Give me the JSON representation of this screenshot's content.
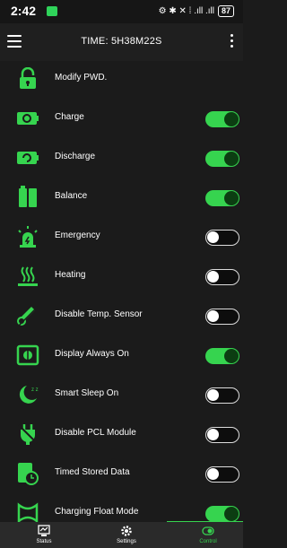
{
  "status_bar": {
    "time": "2:42",
    "icons": "⚙ ✱ ✕ ⁞ .ıll .ıll",
    "battery": "87"
  },
  "toolbar": {
    "title": "TIME: 5H38M22S"
  },
  "colors": {
    "accent": "#36d44f",
    "background": "#1b1b1b"
  },
  "rows": [
    {
      "label": "Modify PWD.",
      "icon": "lock-icon",
      "toggle": null
    },
    {
      "label": "Charge",
      "icon": "battery-charge-icon",
      "toggle": true
    },
    {
      "label": "Discharge",
      "icon": "battery-discharge-icon",
      "toggle": true
    },
    {
      "label": "Balance",
      "icon": "battery-balance-icon",
      "toggle": true
    },
    {
      "label": "Emergency",
      "icon": "emergency-light-icon",
      "toggle": false
    },
    {
      "label": "Heating",
      "icon": "heating-icon",
      "toggle": false
    },
    {
      "label": "Disable Temp. Sensor",
      "icon": "temp-sensor-off-icon",
      "toggle": false
    },
    {
      "label": "Display Always On",
      "icon": "display-icon",
      "toggle": true
    },
    {
      "label": "Smart Sleep On",
      "icon": "moon-sleep-icon",
      "toggle": false
    },
    {
      "label": "Disable PCL Module",
      "icon": "plug-off-icon",
      "toggle": false
    },
    {
      "label": "Timed Stored Data",
      "icon": "timed-data-icon",
      "toggle": false
    },
    {
      "label": "Charging Float Mode",
      "icon": "float-mode-icon",
      "toggle": true
    }
  ],
  "bottom_nav": [
    {
      "label": "Status",
      "icon": "status-icon",
      "active": false
    },
    {
      "label": "Settings",
      "icon": "gear-icon",
      "active": false
    },
    {
      "label": "Control",
      "icon": "control-icon",
      "active": true
    }
  ]
}
